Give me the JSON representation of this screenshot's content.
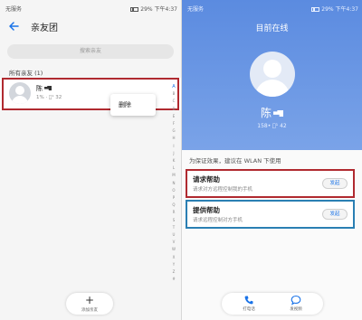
{
  "left": {
    "status": {
      "carrier": "无服务",
      "battery": "29%",
      "time": "下午4:37"
    },
    "title": "亲友团",
    "search_placeholder": "搜索亲友",
    "section_label": "所有亲友 (1)",
    "contact": {
      "name": "陈",
      "phone": "1% · ﾞ¹ 32"
    },
    "context_menu": {
      "delete": "删除"
    },
    "index_letters": [
      "A",
      "B",
      "C",
      "D",
      "E",
      "F",
      "G",
      "H",
      "I",
      "J",
      "K",
      "L",
      "M",
      "N",
      "O",
      "P",
      "Q",
      "R",
      "S",
      "T",
      "U",
      "V",
      "W",
      "X",
      "Y",
      "Z",
      "#"
    ],
    "add_button": {
      "symbol": "+",
      "label": "添加亲友"
    }
  },
  "right": {
    "status": {
      "carrier": "无服务",
      "battery": "29%",
      "time": "下午4:37"
    },
    "online_label": "目前在线",
    "contact": {
      "name": "陈",
      "phone": "158• ﾞ¹ 42"
    },
    "wlan_tip": "为保证效果，建议在 WLAN 下使用",
    "request_help": {
      "title": "请求帮助",
      "desc": "请求对方远程控制我的手机",
      "button": "发起"
    },
    "offer_help": {
      "title": "提供帮助",
      "desc": "请求远程控制对方手机",
      "button": "发起"
    },
    "bottom": {
      "call_label": "打电话",
      "video_label": "发视频"
    }
  },
  "colors": {
    "accent": "#1a73e8",
    "call_bg": "#6a96e4",
    "red_highlight": "#b02a30",
    "blue_highlight": "#2a7fb3"
  }
}
